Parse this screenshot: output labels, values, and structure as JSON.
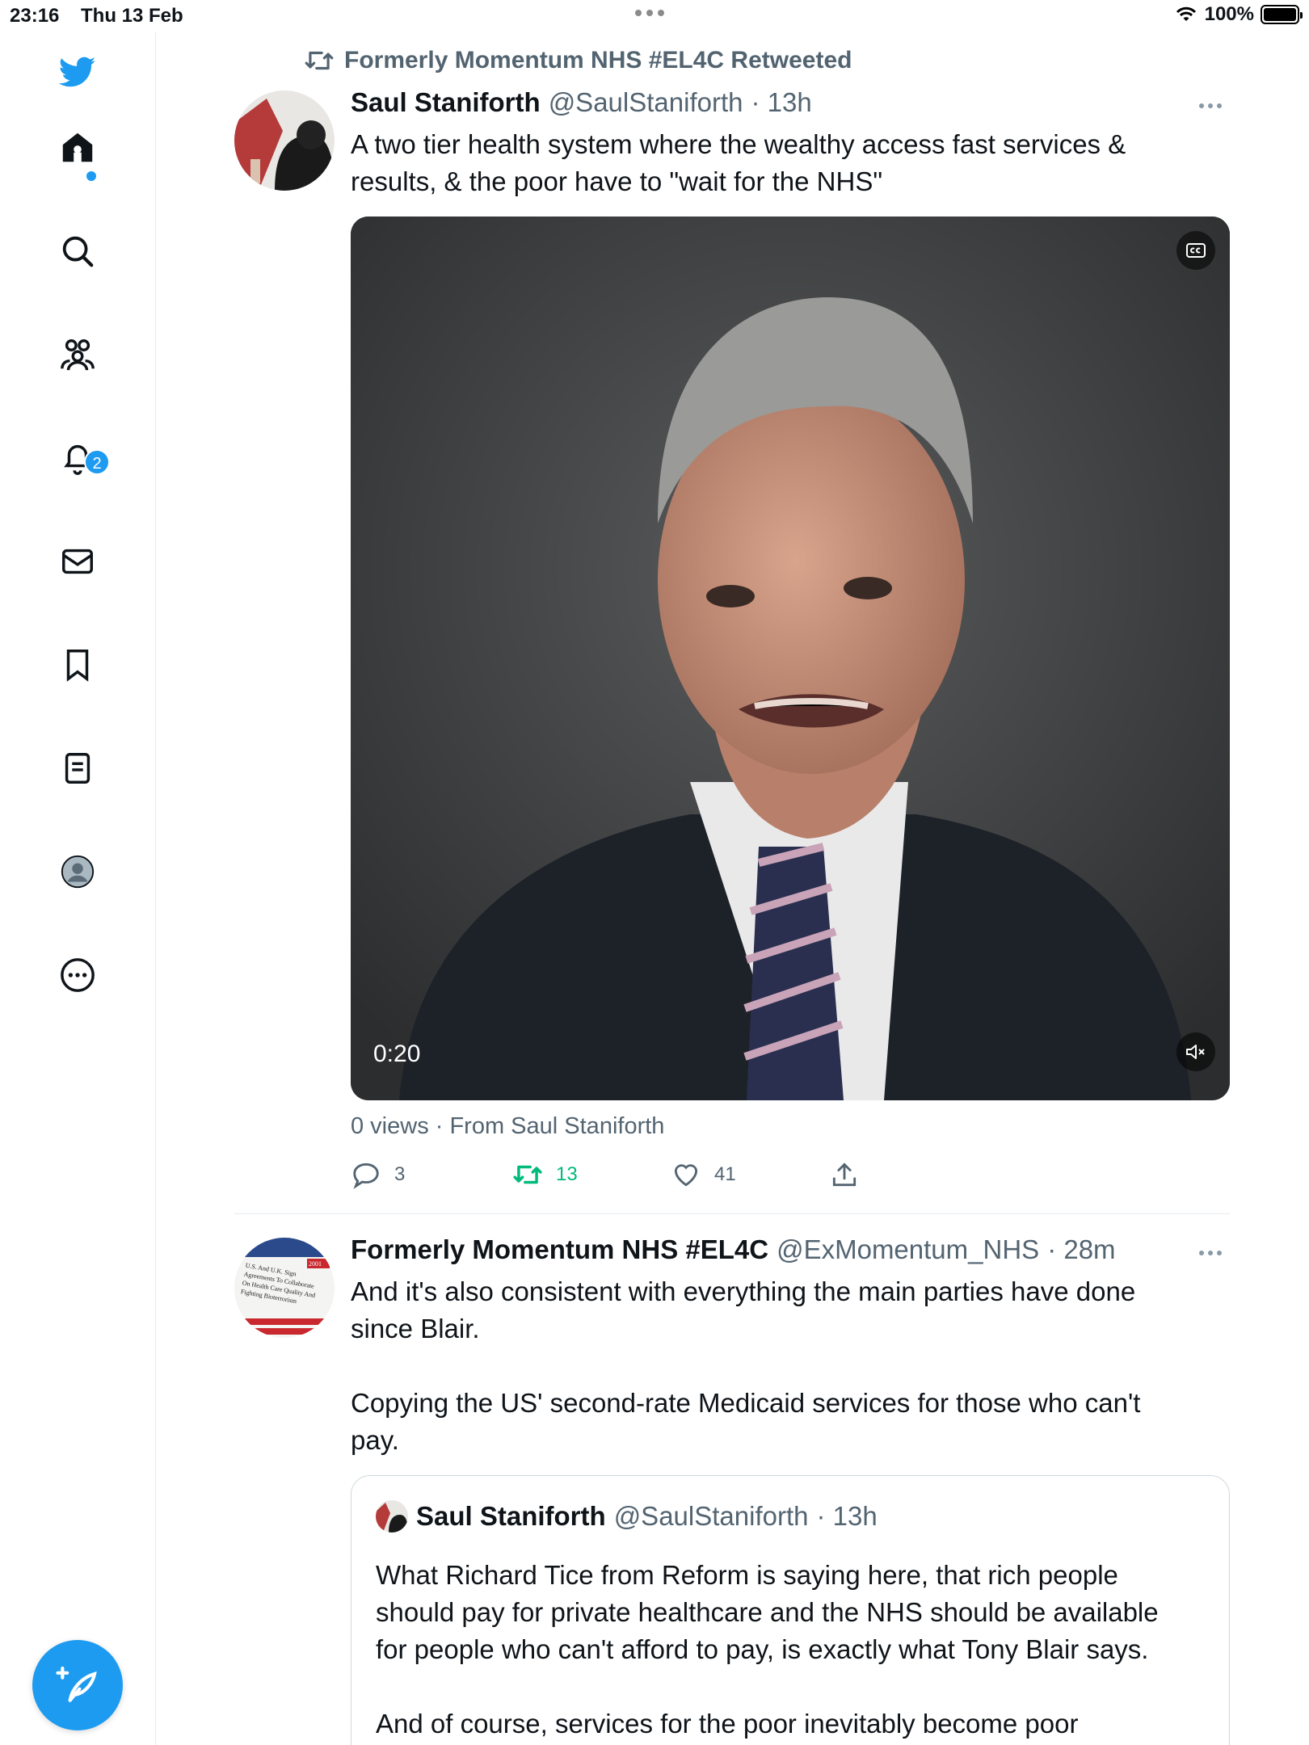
{
  "status_bar": {
    "time": "23:16",
    "date": "Thu 13 Feb",
    "battery": "100%"
  },
  "sidebar": {
    "items": [
      "twitter-logo",
      "home",
      "search",
      "communities",
      "notifications",
      "messages",
      "bookmarks",
      "lists",
      "profile",
      "more"
    ],
    "notification_count": "2"
  },
  "colors": {
    "accent": "#1d9bf0",
    "retweet_green": "#00ba7c",
    "secondary_text": "#536471"
  },
  "tweet1": {
    "retweeted_by": "Formerly Momentum NHS #EL4C Retweeted",
    "name": "Saul Staniforth",
    "handle": "@SaulStaniforth",
    "time": "· 13h",
    "text": "A two tier health system where the wealthy access fast services &\nresults, & the poor have to \"wait for the NHS\"",
    "video_time": "0:20",
    "views": "0 views · From Saul Staniforth",
    "replies": "3",
    "retweets": "13",
    "likes": "41"
  },
  "tweet2": {
    "name": "Formerly Momentum NHS #EL4C",
    "handle": "@ExMomentum_NHS",
    "time": "· 28m",
    "text": "And it's also consistent with everything the main parties have done\nsince Blair.\n\nCopying the US' second-rate Medicaid services for those who can't\npay.",
    "avatar_text": "U.S. And U.K. Sign Agreements To Collaborate On Health Care Quality And Fighting Bioterrorism",
    "avatar_year": "2001",
    "quote": {
      "name": "Saul Staniforth",
      "handle": "@SaulStaniforth",
      "time": "· 13h",
      "text": "What Richard Tice from Reform is saying here, that rich people\nshould pay for private healthcare and the NHS should be available\nfor people who can't afford to pay, is exactly what Tony Blair says.\n\nAnd of course, services for the poor inevitably become poor\nservices."
    }
  }
}
